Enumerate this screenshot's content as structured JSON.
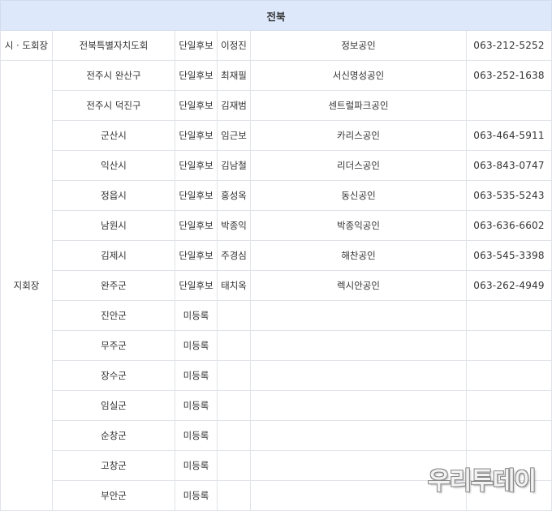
{
  "header": {
    "title": "전북"
  },
  "governor": {
    "role": "시 · 도회장",
    "region": "전북특별자치도회",
    "status": "단일후보",
    "name": "이정진",
    "office": "정보공인",
    "phone": "063-212-5252"
  },
  "branch_label": "지회장",
  "branches": [
    {
      "region": "전주시 완산구",
      "status": "단일후보",
      "name": "최재필",
      "office": "서신명성공인",
      "phone": "063-252-1638"
    },
    {
      "region": "전주시 덕진구",
      "status": "단일후보",
      "name": "김재범",
      "office": "센트럴파크공인",
      "phone": ""
    },
    {
      "region": "군산시",
      "status": "단일후보",
      "name": "임근보",
      "office": "카리스공인",
      "phone": "063-464-5911"
    },
    {
      "region": "익산시",
      "status": "단일후보",
      "name": "김남철",
      "office": "리더스공인",
      "phone": "063-843-0747"
    },
    {
      "region": "정읍시",
      "status": "단일후보",
      "name": "홍성옥",
      "office": "동신공인",
      "phone": "063-535-5243"
    },
    {
      "region": "남원시",
      "status": "단일후보",
      "name": "박종익",
      "office": "박종익공인",
      "phone": "063-636-6602"
    },
    {
      "region": "김제시",
      "status": "단일후보",
      "name": "주경심",
      "office": "해찬공인",
      "phone": "063-545-3398"
    },
    {
      "region": "완주군",
      "status": "단일후보",
      "name": "태치옥",
      "office": "렉시안공인",
      "phone": "063-262-4949"
    },
    {
      "region": "진안군",
      "status": "미등록",
      "name": "",
      "office": "",
      "phone": ""
    },
    {
      "region": "무주군",
      "status": "미등록",
      "name": "",
      "office": "",
      "phone": ""
    },
    {
      "region": "장수군",
      "status": "미등록",
      "name": "",
      "office": "",
      "phone": ""
    },
    {
      "region": "임실군",
      "status": "미등록",
      "name": "",
      "office": "",
      "phone": ""
    },
    {
      "region": "순창군",
      "status": "미등록",
      "name": "",
      "office": "",
      "phone": ""
    },
    {
      "region": "고창군",
      "status": "미등록",
      "name": "",
      "office": "",
      "phone": ""
    },
    {
      "region": "부안군",
      "status": "미등록",
      "name": "",
      "office": "",
      "phone": ""
    }
  ],
  "watermark": "우리투데이"
}
